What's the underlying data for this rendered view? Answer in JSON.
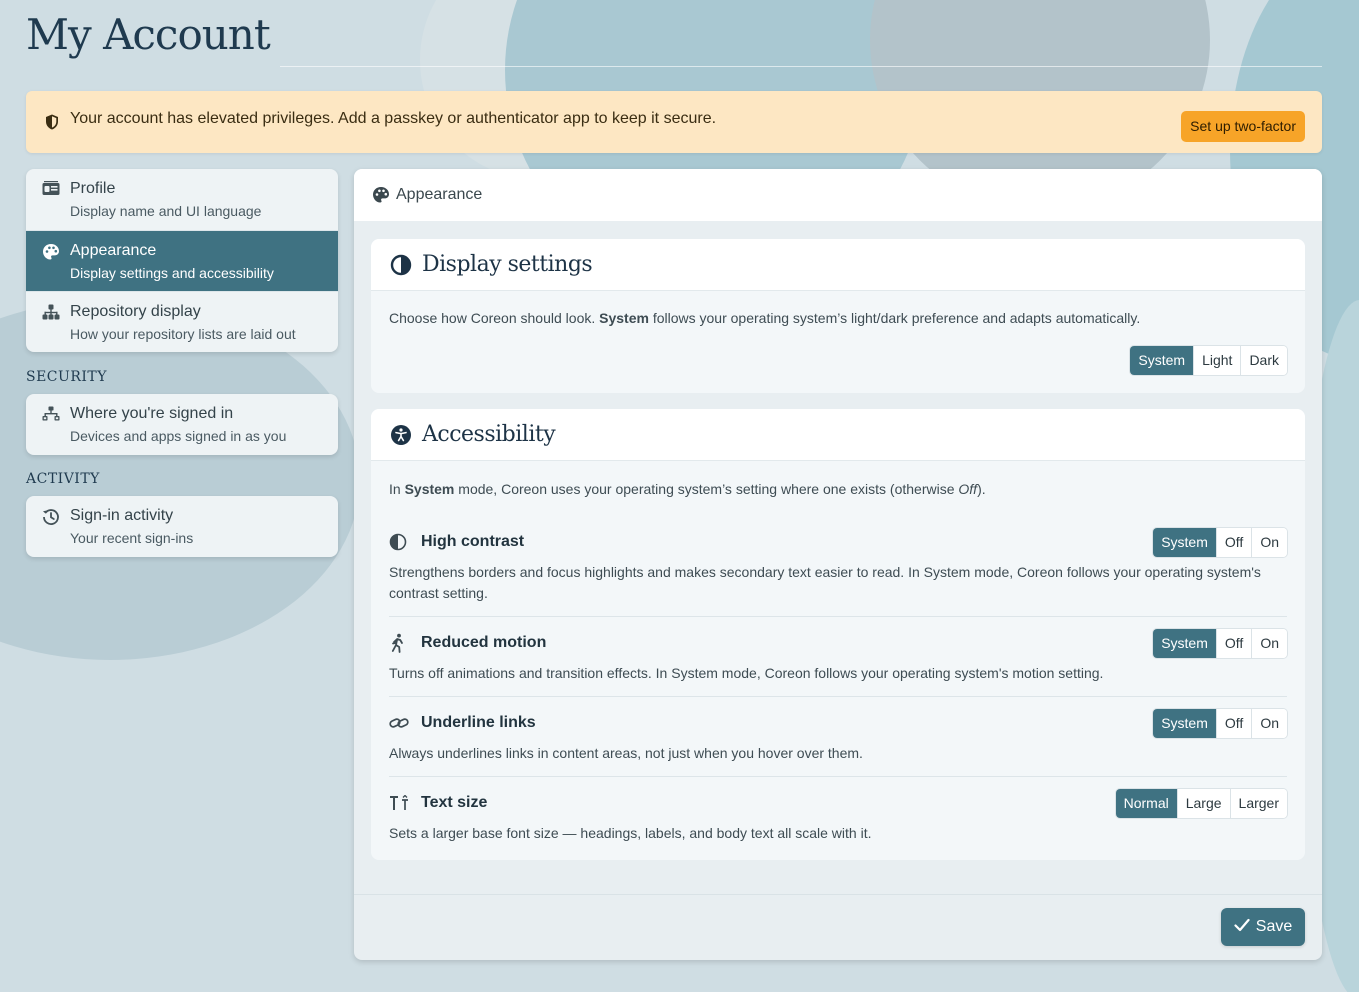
{
  "page": {
    "title": "My Account"
  },
  "alert": {
    "icon": "shield-icon",
    "text": "Your account has elevated privileges. Add a passkey or authenticator app to keep it secure.",
    "button": "Set up two-factor"
  },
  "sidebar": {
    "groups": [
      {
        "heading": "",
        "items": [
          {
            "icon": "id-card-icon",
            "label": "Profile",
            "description": "Display name and UI language",
            "active": false
          },
          {
            "icon": "palette-icon",
            "label": "Appearance",
            "description": "Display settings and accessibility",
            "active": true
          },
          {
            "icon": "hierarchy-icon",
            "label": "Repository display",
            "description": "How your repository lists are laid out",
            "active": false
          }
        ]
      },
      {
        "heading": "SECURITY",
        "items": [
          {
            "icon": "network-icon",
            "label": "Where you're signed in",
            "description": "Devices and apps signed in as you",
            "active": false
          }
        ]
      },
      {
        "heading": "ACTIVITY",
        "items": [
          {
            "icon": "history-icon",
            "label": "Sign-in activity",
            "description": "Your recent sign-ins",
            "active": false
          }
        ]
      }
    ]
  },
  "main": {
    "header": "Appearance",
    "display_settings": {
      "title": "Display settings",
      "description_before": "Choose how Coreon should look. ",
      "description_bold": "System",
      "description_after": " follows your operating system’s light/dark preference and adapts automatically.",
      "options": [
        "System",
        "Light",
        "Dark"
      ],
      "selected": "System"
    },
    "accessibility": {
      "title": "Accessibility",
      "intro_before": "In ",
      "intro_bold": "System",
      "intro_middle": " mode, Coreon uses your operating system’s setting where one exists (otherwise ",
      "intro_italic": "Off",
      "intro_after": ").",
      "settings": [
        {
          "icon": "contrast-icon",
          "title": "High contrast",
          "description": "Strengthens borders and focus highlights and makes secondary text easier to read. In System mode, Coreon follows your operating system's contrast setting.",
          "options": [
            "System",
            "Off",
            "On"
          ],
          "selected": "System"
        },
        {
          "icon": "running-person-icon",
          "title": "Reduced motion",
          "description": "Turns off animations and transition effects. In System mode, Coreon follows your operating system's motion setting.",
          "options": [
            "System",
            "Off",
            "On"
          ],
          "selected": "System"
        },
        {
          "icon": "link-icon",
          "title": "Underline links",
          "description": "Always underlines links in content areas, not just when you hover over them.",
          "options": [
            "System",
            "Off",
            "On"
          ],
          "selected": "System"
        },
        {
          "icon": "text-size-icon",
          "title": "Text size",
          "description": "Sets a larger base font size — headings, labels, and body text all scale with it.",
          "options": [
            "Normal",
            "Large",
            "Larger"
          ],
          "selected": "Normal"
        }
      ]
    },
    "save_label": "Save"
  },
  "colors": {
    "accent": "#3f7282",
    "warning_bg": "#fde7c3",
    "warning_button": "#f7a428"
  }
}
